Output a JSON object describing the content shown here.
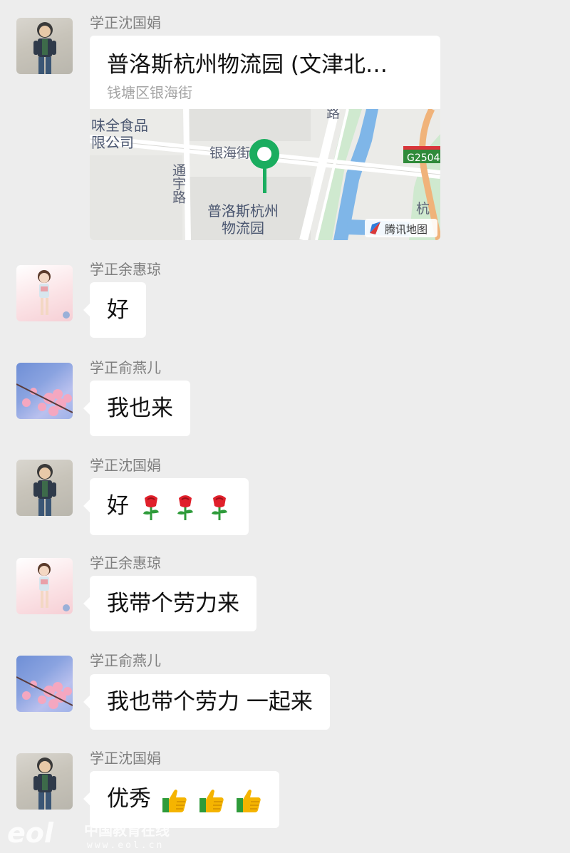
{
  "messages": [
    {
      "sender": "学正沈国娟",
      "avatar": "avatar-shen",
      "type": "location",
      "location_title": "普洛斯杭州物流园 (文津北…",
      "location_subtitle": "钱塘区银海街",
      "map": {
        "poi_company": [
          "味全食品",
          "限公司"
        ],
        "road_yinhai": "银海街",
        "road_tongyu": "通宇路",
        "road_lu": "路",
        "place_label": [
          "普洛斯杭州",
          "物流园"
        ],
        "highway_shield": "G2504",
        "road_hang": "杭",
        "provider_label": "腾讯地图"
      }
    },
    {
      "sender": "学正余惠琼",
      "avatar": "avatar-yu",
      "type": "text",
      "text": "好"
    },
    {
      "sender": "学正俞燕儿",
      "avatar": "avatar-yan",
      "type": "text",
      "text": "我也来"
    },
    {
      "sender": "学正沈国娟",
      "avatar": "avatar-shen",
      "type": "text",
      "text": "好",
      "emojis": [
        "rose-emoji",
        "rose-emoji",
        "rose-emoji"
      ]
    },
    {
      "sender": "学正余惠琼",
      "avatar": "avatar-yu",
      "type": "text",
      "text": "我带个劳力来"
    },
    {
      "sender": "学正俞燕儿",
      "avatar": "avatar-yan",
      "type": "text",
      "text": "我也带个劳力 一起来"
    },
    {
      "sender": "学正沈国娟",
      "avatar": "avatar-shen",
      "type": "text",
      "text": "优秀",
      "emojis": [
        "thumbs-up-emoji",
        "thumbs-up-emoji",
        "thumbs-up-emoji"
      ]
    }
  ],
  "watermark": {
    "logo_text": "eol",
    "cn_text": "中国教育在线",
    "url_text": "www.eol.cn"
  },
  "colors": {
    "background": "#ededed",
    "bubble": "#ffffff",
    "name_text": "#7f7f7f",
    "map_pin": "#1aad5f",
    "map_water": "#7fb6e8",
    "map_green": "#c9e8c9",
    "rose": "#e0202b",
    "thumb": "#f5b400"
  }
}
